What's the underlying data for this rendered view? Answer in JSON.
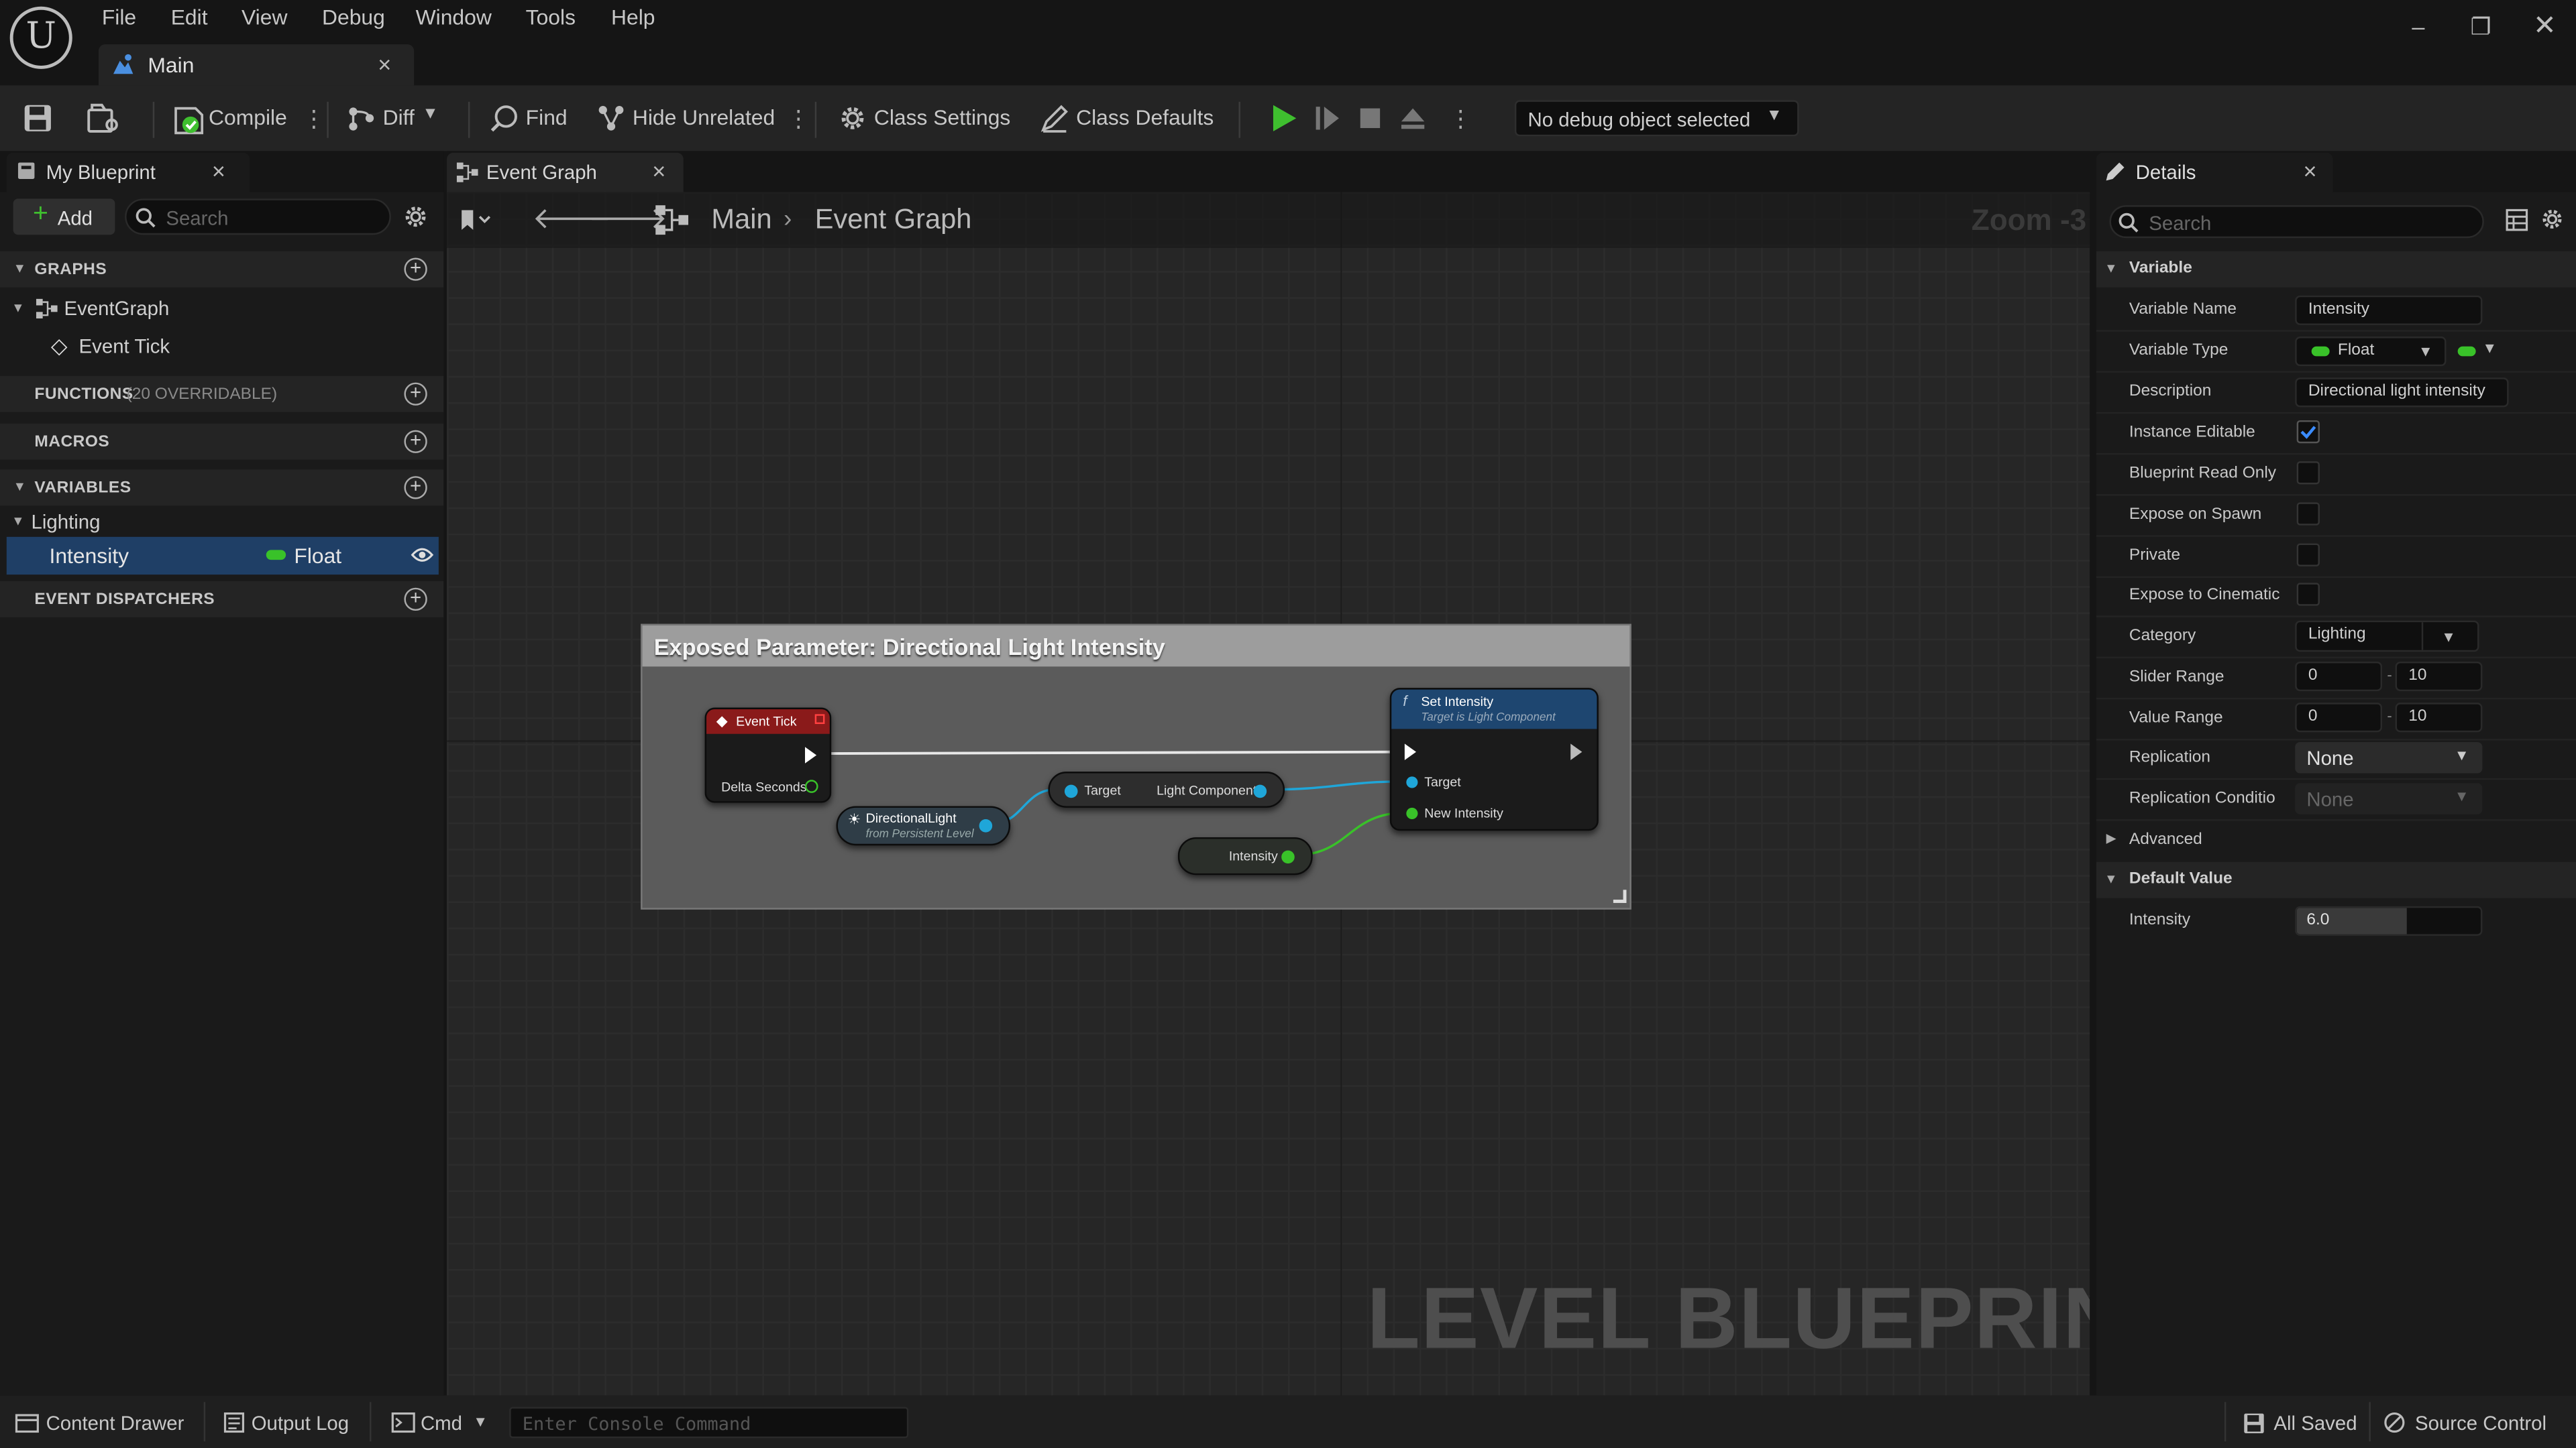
{
  "menu": [
    "File",
    "Edit",
    "View",
    "Debug",
    "Window",
    "Tools",
    "Help"
  ],
  "doc_tab": {
    "label": "Main"
  },
  "toolbar": {
    "compile": "Compile",
    "diff": "Diff",
    "find": "Find",
    "hide_unrelated": "Hide Unrelated",
    "class_settings": "Class Settings",
    "class_defaults": "Class Defaults",
    "debug_object": "No debug object selected"
  },
  "my_blueprint": {
    "tab_label": "My Blueprint",
    "add_label": "Add",
    "search_placeholder": "Search",
    "graphs_header": "GRAPHS",
    "event_graph": "EventGraph",
    "event_tick": "Event Tick",
    "functions_header": "FUNCTIONS",
    "functions_note": "(20 OVERRIDABLE)",
    "macros_header": "MACROS",
    "variables_header": "VARIABLES",
    "category": "Lighting",
    "variable_name": "Intensity",
    "variable_type": "Float",
    "dispatchers_header": "EVENT DISPATCHERS"
  },
  "graph": {
    "tab_label": "Event Graph",
    "breadcrumb_root": "Main",
    "breadcrumb_current": "Event Graph",
    "zoom": "Zoom -3",
    "watermark": "LEVEL BLUEPRINT",
    "comment_title": "Exposed Parameter: Directional Light Intensity",
    "nodes": {
      "event_tick": {
        "title": "Event Tick",
        "pin_delta": "Delta Seconds"
      },
      "directional_light": {
        "title": "DirectionalLight",
        "subtitle": "from Persistent Level"
      },
      "light_component": {
        "pin_target": "Target",
        "pin_out": "Light Component"
      },
      "intensity_getter": {
        "title": "Intensity"
      },
      "set_intensity": {
        "title": "Set Intensity",
        "subtitle": "Target is Light Component",
        "pin_target": "Target",
        "pin_new": "New Intensity"
      }
    }
  },
  "details": {
    "tab_label": "Details",
    "search_placeholder": "Search",
    "variable_header": "Variable",
    "labels": {
      "variable_name": "Variable Name",
      "variable_type": "Variable Type",
      "description": "Description",
      "instance_editable": "Instance Editable",
      "blueprint_read_only": "Blueprint Read Only",
      "expose_on_spawn": "Expose on Spawn",
      "private": "Private",
      "expose_to_cinematics": "Expose to Cinematic",
      "category": "Category",
      "slider_range": "Slider Range",
      "value_range": "Value Range",
      "replication": "Replication",
      "replication_condition": "Replication Conditio"
    },
    "values": {
      "variable_name": "Intensity",
      "variable_type": "Float",
      "description": "Directional light intensity",
      "instance_editable": true,
      "blueprint_read_only": false,
      "expose_on_spawn": false,
      "private": false,
      "expose_to_cinematics": false,
      "category": "Lighting",
      "slider_min": "0",
      "slider_max": "10",
      "value_min": "0",
      "value_max": "10",
      "range_separator": "-",
      "replication": "None",
      "replication_condition": "None"
    },
    "advanced_header": "Advanced",
    "default_value_header": "Default Value",
    "default_label": "Intensity",
    "default_value": "6.0",
    "default_fill": 0.6
  },
  "status_bar": {
    "content_drawer": "Content Drawer",
    "output_log": "Output Log",
    "cmd": "Cmd",
    "console_placeholder": "Enter Console Command",
    "all_saved": "All Saved",
    "source_control": "Source Control"
  },
  "colors": {
    "accent_blue": "#1f3f66",
    "float_pin": "#39c229",
    "object_pin": "#1fa6d9",
    "event_node": "#8a1a1a",
    "function_node": "#1e4670",
    "play_green": "#3fbf2f"
  }
}
